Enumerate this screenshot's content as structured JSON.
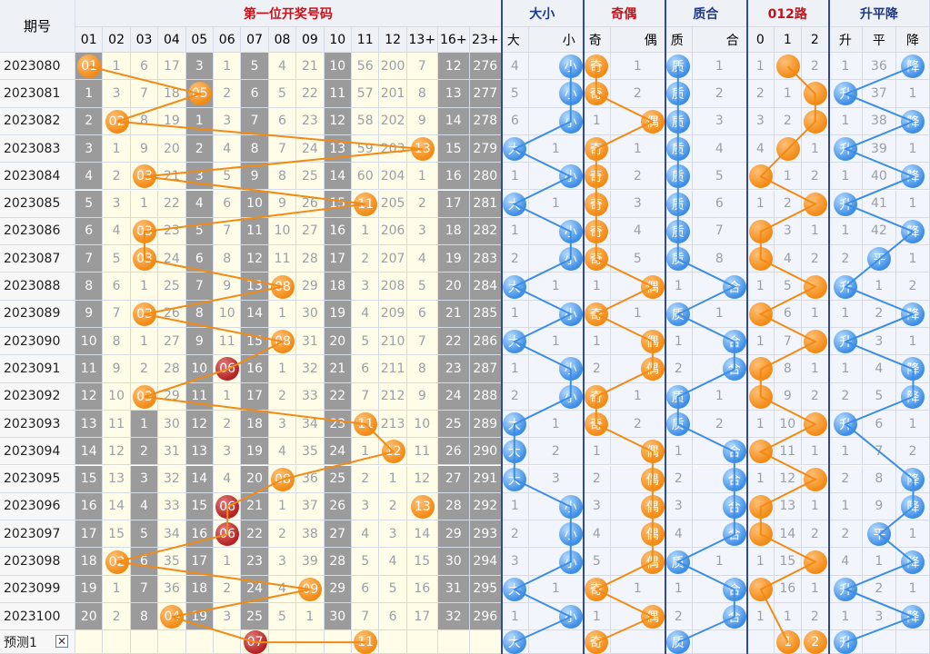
{
  "header": {
    "period_label": "期号",
    "groups": [
      "第一位开奖号码",
      "大小",
      "奇偶",
      "质合",
      "012路",
      "升平降"
    ],
    "sub": [
      "01",
      "02",
      "03",
      "04",
      "05",
      "06",
      "07",
      "08",
      "09",
      "10",
      "11",
      "12",
      "13+",
      "16+",
      "23+",
      "大",
      "小",
      "奇",
      "偶",
      "质",
      "合",
      "0",
      "1",
      "2",
      "升",
      "平",
      "降"
    ]
  },
  "colors": {
    "title_red": "#c0141b",
    "title_blue": "#1e3a8a",
    "orange": "#f28a14",
    "red": "#b52121",
    "blue": "#3d8de5",
    "line_orange": "#f28a14",
    "line_blue": "#3d8de5"
  },
  "rows": [
    {
      "p": "2023080",
      "n": [
        "01",
        "1",
        "6",
        "17",
        "3",
        "1",
        "5",
        "4",
        "21",
        "10",
        "56",
        "200",
        "7",
        "12",
        "276",
        "4",
        "小",
        "奇",
        "1",
        "质",
        "1",
        "1",
        "1",
        "2",
        "1",
        "36",
        "降"
      ]
    },
    {
      "p": "2023081",
      "n": [
        "1",
        "3",
        "7",
        "18",
        "05",
        "2",
        "6",
        "5",
        "22",
        "11",
        "57",
        "201",
        "8",
        "13",
        "277",
        "5",
        "小",
        "奇",
        "2",
        "质",
        "2",
        "2",
        "1",
        "2",
        "升",
        "37",
        "1"
      ]
    },
    {
      "p": "2023082",
      "n": [
        "2",
        "02",
        "8",
        "19",
        "1",
        "3",
        "7",
        "6",
        "23",
        "12",
        "58",
        "202",
        "9",
        "14",
        "278",
        "6",
        "小",
        "1",
        "偶",
        "质",
        "3",
        "3",
        "2",
        "2",
        "1",
        "38",
        "降"
      ]
    },
    {
      "p": "2023083",
      "n": [
        "3",
        "1",
        "9",
        "20",
        "2",
        "4",
        "8",
        "7",
        "24",
        "13",
        "59",
        "203",
        "13",
        "15",
        "279",
        "大",
        "1",
        "奇",
        "1",
        "质",
        "4",
        "4",
        "1",
        "1",
        "升",
        "39",
        "1"
      ]
    },
    {
      "p": "2023084",
      "n": [
        "4",
        "2",
        "03",
        "21",
        "3",
        "5",
        "9",
        "8",
        "25",
        "14",
        "60",
        "204",
        "1",
        "16",
        "280",
        "1",
        "小",
        "奇",
        "2",
        "质",
        "5",
        "0",
        "1",
        "2",
        "1",
        "40",
        "降"
      ]
    },
    {
      "p": "2023085",
      "n": [
        "5",
        "3",
        "1",
        "22",
        "4",
        "6",
        "10",
        "9",
        "26",
        "15",
        "11",
        "205",
        "2",
        "17",
        "281",
        "大",
        "1",
        "奇",
        "3",
        "质",
        "6",
        "1",
        "2",
        "2",
        "升",
        "41",
        "1"
      ]
    },
    {
      "p": "2023086",
      "n": [
        "6",
        "4",
        "03",
        "23",
        "5",
        "7",
        "11",
        "10",
        "27",
        "16",
        "1",
        "206",
        "3",
        "18",
        "282",
        "1",
        "小",
        "奇",
        "4",
        "质",
        "7",
        "0",
        "3",
        "1",
        "1",
        "42",
        "降"
      ]
    },
    {
      "p": "2023087",
      "n": [
        "7",
        "5",
        "03",
        "24",
        "6",
        "8",
        "12",
        "11",
        "28",
        "17",
        "2",
        "207",
        "4",
        "19",
        "283",
        "2",
        "小",
        "奇",
        "5",
        "质",
        "8",
        "0",
        "4",
        "2",
        "2",
        "平",
        "1"
      ]
    },
    {
      "p": "2023088",
      "n": [
        "8",
        "6",
        "1",
        "25",
        "7",
        "9",
        "13",
        "08",
        "29",
        "18",
        "3",
        "208",
        "5",
        "20",
        "284",
        "大",
        "1",
        "1",
        "偶",
        "1",
        "合",
        "1",
        "5",
        "2",
        "升",
        "1",
        "2"
      ]
    },
    {
      "p": "2023089",
      "n": [
        "9",
        "7",
        "03",
        "26",
        "8",
        "10",
        "14",
        "1",
        "30",
        "19",
        "4",
        "209",
        "6",
        "21",
        "285",
        "1",
        "小",
        "奇",
        "1",
        "质",
        "1",
        "0",
        "6",
        "1",
        "1",
        "2",
        "降"
      ]
    },
    {
      "p": "2023090",
      "n": [
        "10",
        "8",
        "1",
        "27",
        "9",
        "11",
        "15",
        "08",
        "31",
        "20",
        "5",
        "210",
        "7",
        "22",
        "286",
        "大",
        "1",
        "1",
        "偶",
        "1",
        "合",
        "1",
        "7",
        "2",
        "升",
        "3",
        "1"
      ]
    },
    {
      "p": "2023091",
      "n": [
        "11",
        "9",
        "2",
        "28",
        "10",
        "06",
        "16",
        "1",
        "32",
        "21",
        "6",
        "211",
        "8",
        "23",
        "287",
        "1",
        "小",
        "2",
        "偶",
        "2",
        "合",
        "0",
        "8",
        "1",
        "1",
        "4",
        "降"
      ]
    },
    {
      "p": "2023092",
      "n": [
        "12",
        "10",
        "03",
        "29",
        "11",
        "1",
        "17",
        "2",
        "33",
        "22",
        "7",
        "212",
        "9",
        "24",
        "288",
        "2",
        "小",
        "奇",
        "1",
        "质",
        "1",
        "0",
        "9",
        "2",
        "2",
        "5",
        "降"
      ]
    },
    {
      "p": "2023093",
      "n": [
        "13",
        "11",
        "1",
        "30",
        "12",
        "2",
        "18",
        "3",
        "34",
        "23",
        "11",
        "213",
        "10",
        "25",
        "289",
        "大",
        "1",
        "奇",
        "2",
        "质",
        "2",
        "1",
        "10",
        "2",
        "升",
        "6",
        "1"
      ]
    },
    {
      "p": "2023094",
      "n": [
        "14",
        "12",
        "2",
        "31",
        "13",
        "3",
        "19",
        "4",
        "35",
        "24",
        "1",
        "12",
        "11",
        "26",
        "290",
        "大",
        "2",
        "1",
        "偶",
        "1",
        "合",
        "0",
        "11",
        "1",
        "1",
        "7",
        "2"
      ]
    },
    {
      "p": "2023095",
      "n": [
        "15",
        "13",
        "3",
        "32",
        "14",
        "4",
        "20",
        "08",
        "36",
        "25",
        "2",
        "1",
        "12",
        "27",
        "291",
        "大",
        "3",
        "2",
        "偶",
        "2",
        "合",
        "1",
        "12",
        "2",
        "2",
        "8",
        "降"
      ]
    },
    {
      "p": "2023096",
      "n": [
        "16",
        "14",
        "4",
        "33",
        "15",
        "06",
        "21",
        "1",
        "37",
        "26",
        "3",
        "2",
        "13",
        "28",
        "292",
        "1",
        "小",
        "3",
        "偶",
        "3",
        "合",
        "0",
        "13",
        "1",
        "1",
        "9",
        "降"
      ]
    },
    {
      "p": "2023097",
      "n": [
        "17",
        "15",
        "5",
        "34",
        "16",
        "06",
        "22",
        "2",
        "38",
        "27",
        "4",
        "3",
        "14",
        "29",
        "293",
        "2",
        "小",
        "4",
        "偶",
        "4",
        "合",
        "0",
        "14",
        "2",
        "2",
        "平",
        "1"
      ]
    },
    {
      "p": "2023098",
      "n": [
        "18",
        "02",
        "6",
        "35",
        "17",
        "1",
        "23",
        "3",
        "39",
        "28",
        "5",
        "4",
        "15",
        "30",
        "294",
        "3",
        "小",
        "5",
        "偶",
        "质",
        "1",
        "1",
        "15",
        "2",
        "4",
        "1",
        "降"
      ]
    },
    {
      "p": "2023099",
      "n": [
        "19",
        "1",
        "7",
        "36",
        "18",
        "2",
        "24",
        "4",
        "09",
        "29",
        "6",
        "5",
        "16",
        "31",
        "295",
        "大",
        "1",
        "奇",
        "1",
        "1",
        "合",
        "0",
        "16",
        "1",
        "升",
        "2",
        "1"
      ]
    },
    {
      "p": "2023100",
      "n": [
        "20",
        "2",
        "8",
        "04",
        "19",
        "3",
        "25",
        "5",
        "1",
        "30",
        "7",
        "6",
        "17",
        "32",
        "296",
        "1",
        "小",
        "1",
        "偶",
        "2",
        "合",
        "1",
        "1",
        "2",
        "1",
        "3",
        "降"
      ]
    }
  ],
  "predict": {
    "label": "预测1",
    "close_label": "✕",
    "ball_r": "07",
    "ball_o": "11",
    "big": "大",
    "odd": "奇",
    "prime": "质",
    "r1": "1",
    "r2": "2",
    "up": "升"
  }
}
